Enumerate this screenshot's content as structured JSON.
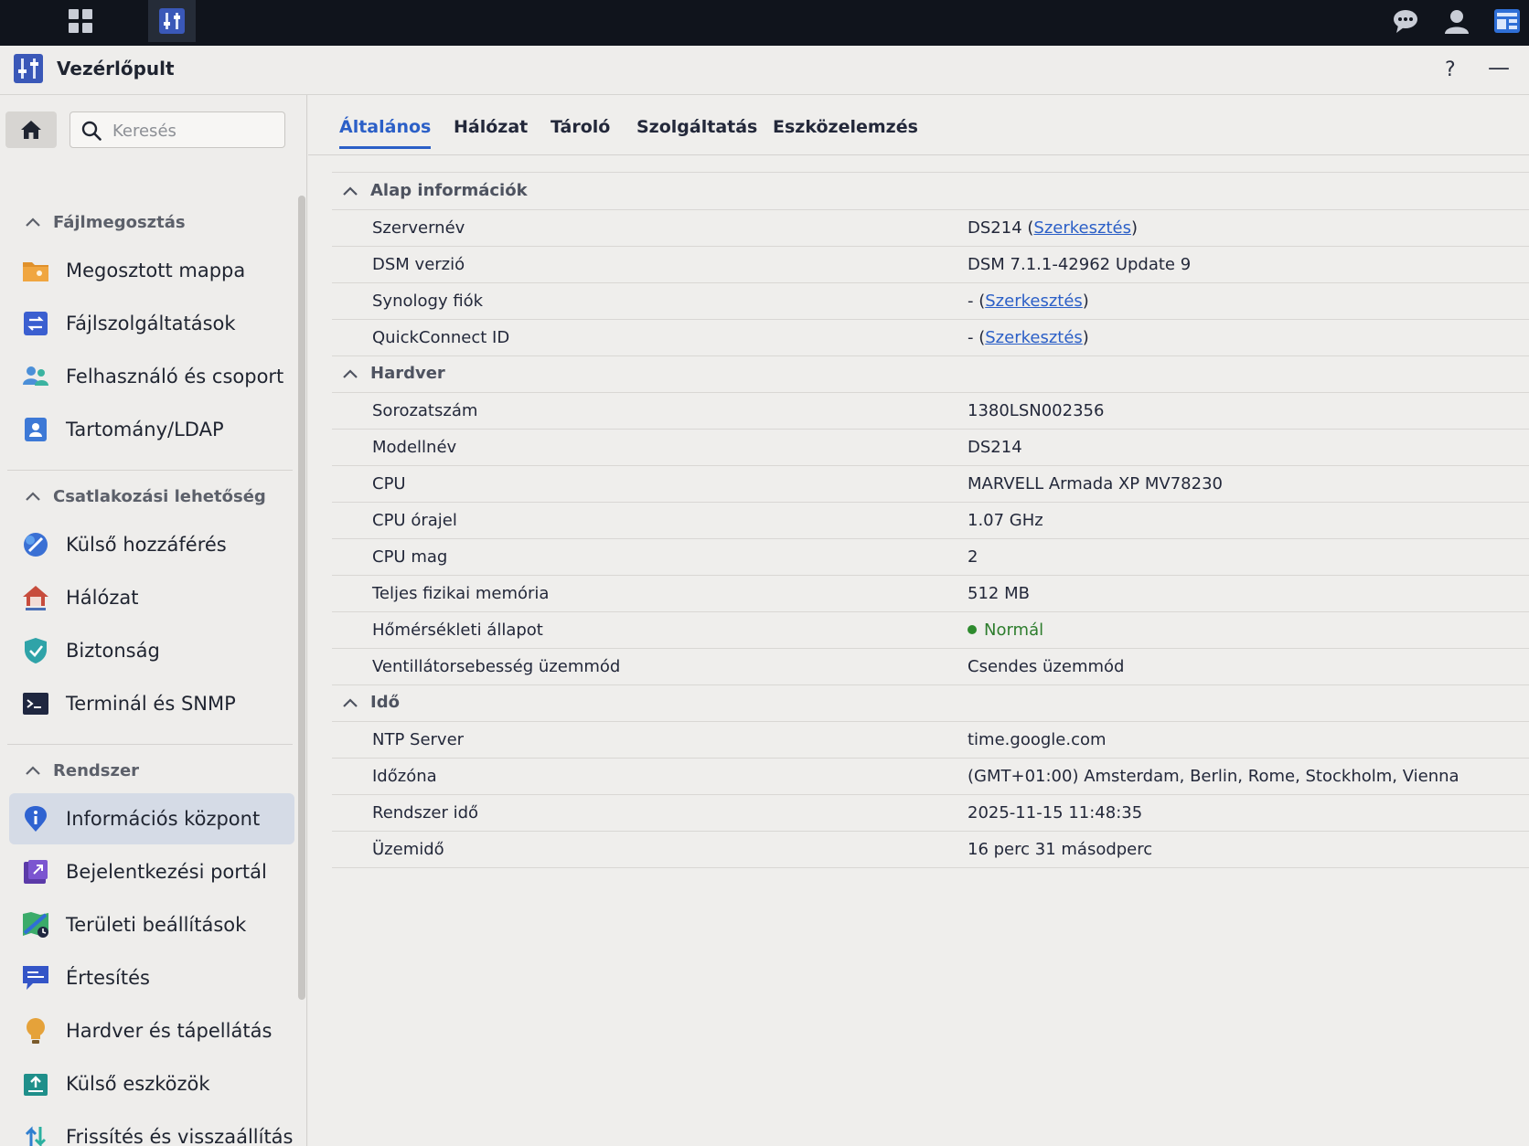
{
  "window": {
    "title": "Vezérlőpult",
    "help": "?",
    "minimize": "—"
  },
  "sidebar": {
    "search_placeholder": "Keresés",
    "sections": [
      {
        "title": "Fájlmegosztás",
        "items": [
          {
            "label": "Megosztott mappa",
            "icon": "folder-icon"
          },
          {
            "label": "Fájlszolgáltatások",
            "icon": "file-services-icon"
          },
          {
            "label": "Felhasználó és csoport",
            "icon": "users-icon"
          },
          {
            "label": "Tartomány/LDAP",
            "icon": "ldap-icon"
          }
        ]
      },
      {
        "title": "Csatlakozási lehetőség",
        "items": [
          {
            "label": "Külső hozzáférés",
            "icon": "external-access-icon"
          },
          {
            "label": "Hálózat",
            "icon": "network-house-icon"
          },
          {
            "label": "Biztonság",
            "icon": "shield-icon"
          },
          {
            "label": "Terminál és SNMP",
            "icon": "terminal-icon"
          }
        ]
      },
      {
        "title": "Rendszer",
        "items": [
          {
            "label": "Információs központ",
            "icon": "info-icon",
            "active": true
          },
          {
            "label": "Bejelentkezési portál",
            "icon": "login-portal-icon"
          },
          {
            "label": "Területi beállítások",
            "icon": "regional-icon"
          },
          {
            "label": "Értesítés",
            "icon": "notification-icon"
          },
          {
            "label": "Hardver és tápellátás",
            "icon": "bulb-icon"
          },
          {
            "label": "Külső eszközök",
            "icon": "external-device-icon"
          },
          {
            "label": "Frissítés és visszaállítás",
            "icon": "update-icon"
          }
        ]
      }
    ]
  },
  "tabs": [
    "Általános",
    "Hálózat",
    "Tároló",
    "Szolgáltatás",
    "Eszközelemzés"
  ],
  "groups": [
    {
      "title": "Alap információk",
      "rows": [
        {
          "label": "Szervernév",
          "value": "DS214",
          "link": "Szerkesztés"
        },
        {
          "label": "DSM verzió",
          "value": "DSM 7.1.1-42962 Update 9"
        },
        {
          "label": "Synology fiók",
          "value": "-",
          "link": "Szerkesztés"
        },
        {
          "label": "QuickConnect ID",
          "value": "-",
          "link": "Szerkesztés"
        }
      ]
    },
    {
      "title": "Hardver",
      "rows": [
        {
          "label": "Sorozatszám",
          "value": "1380LSN002356"
        },
        {
          "label": "Modellnév",
          "value": "DS214"
        },
        {
          "label": "CPU",
          "value": "MARVELL Armada XP MV78230"
        },
        {
          "label": "CPU órajel",
          "value": "1.07 GHz"
        },
        {
          "label": "CPU mag",
          "value": "2"
        },
        {
          "label": "Teljes fizikai memória",
          "value": "512 MB"
        },
        {
          "label": "Hőmérsékleti állapot",
          "value": "Normál",
          "status": "ok"
        },
        {
          "label": "Ventillátorsebesség üzemmód",
          "value": "Csendes üzemmód"
        }
      ]
    },
    {
      "title": "Idő",
      "rows": [
        {
          "label": "NTP Server",
          "value": "time.google.com"
        },
        {
          "label": "Időzóna",
          "value": "(GMT+01:00) Amsterdam, Berlin, Rome, Stockholm, Vienna"
        },
        {
          "label": "Rendszer idő",
          "value": "2025-11-15 11:48:35"
        },
        {
          "label": "Üzemidő",
          "value": "16 perc 31 másodperc"
        }
      ]
    }
  ],
  "colors": {
    "accent": "#2b5fc7",
    "status_ok": "#2e8b2e"
  }
}
